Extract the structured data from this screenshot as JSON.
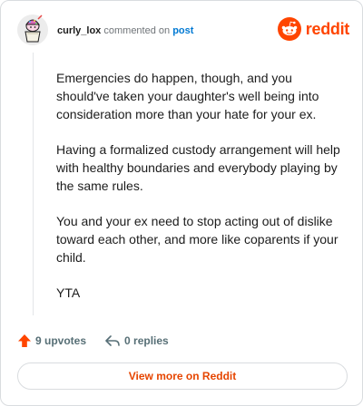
{
  "comment": {
    "username": "curly_lox",
    "action_text": "commented on",
    "target_link": "post",
    "paragraphs": [
      "Emergencies do happen, though, and you should've taken your daughter's well being into consideration more than your hate for your ex.",
      "Having a formalized custody arrangement will help with healthy boundaries and everybody playing by the same rules.",
      "You and your ex need to stop acting out of dislike toward each other, and more like coparents if your child.",
      "YTA"
    ]
  },
  "brand": {
    "name": "reddit",
    "color": "#ff4500"
  },
  "stats": {
    "upvotes": "9 upvotes",
    "replies": "0 replies"
  },
  "view_more_label": "View more on Reddit",
  "icons": {
    "avatar": "snoo-avatar-icon",
    "logo": "reddit-logo-icon",
    "upvote": "upvote-arrow-icon",
    "reply": "reply-arrow-icon"
  }
}
